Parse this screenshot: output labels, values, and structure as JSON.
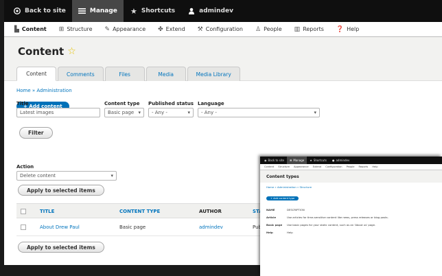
{
  "toolbar": {
    "items": [
      {
        "label": "Back to site",
        "icon": "drupal-drop-icon"
      },
      {
        "label": "Manage",
        "icon": "menu-icon",
        "active": true
      },
      {
        "label": "Shortcuts",
        "icon": "star-icon"
      },
      {
        "label": "admindev",
        "icon": "user-icon"
      }
    ]
  },
  "tray": {
    "items": [
      "Content",
      "Structure",
      "Appearance",
      "Extend",
      "Configuration",
      "People",
      "Reports",
      "Help"
    ]
  },
  "page": {
    "title": "Content",
    "tabs": [
      "Content",
      "Comments",
      "Files",
      "Media",
      "Media Library"
    ],
    "active_tab": 0,
    "breadcrumb": "Home » Administration",
    "add_button": "+ Add content"
  },
  "filters": {
    "title_label": "Title",
    "title_value": "Latest images",
    "type_label": "Content type",
    "type_value": "Basic page",
    "status_label": "Published status",
    "status_value": "- Any -",
    "lang_label": "Language",
    "lang_value": "- Any -",
    "filter_button": "Filter"
  },
  "bulk": {
    "action_label": "Action",
    "action_value": "Delete content",
    "apply_button": "Apply to selected items"
  },
  "table": {
    "headers": [
      "TITLE",
      "CONTENT TYPE",
      "AUTHOR",
      "STA"
    ],
    "rows": [
      {
        "title": "About Drew Paul",
        "type": "Basic page",
        "author": "admindev",
        "status": "Pub"
      }
    ]
  },
  "overlay": {
    "toolbar": [
      "Back to site",
      "Manage",
      "Shortcuts",
      "admindev"
    ],
    "tray": [
      "Content",
      "Structure",
      "Appearance",
      "Extend",
      "Configuration",
      "People",
      "Reports",
      "Help"
    ],
    "title": "Content types",
    "breadcrumb": "Home » Administration » Structure",
    "button": "+ Add content type",
    "rows": [
      {
        "k": "NAME",
        "v": "DESCRIPTION"
      },
      {
        "k": "Article",
        "v": "Use articles for time-sensitive content like news, press releases or blog posts."
      },
      {
        "k": "Basic page",
        "v": "Use basic pages for your static content, such as an 'About us' page."
      },
      {
        "k": "Help",
        "v": "Help"
      }
    ]
  }
}
